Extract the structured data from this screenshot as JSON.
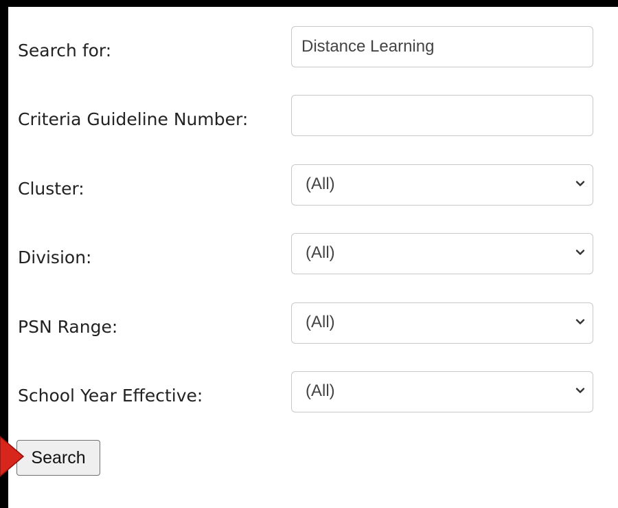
{
  "form": {
    "search_for": {
      "label": "Search for:",
      "value": "Distance Learning"
    },
    "criteria_guideline_number": {
      "label": "Criteria Guideline Number:",
      "value": ""
    },
    "cluster": {
      "label": "Cluster:",
      "selected": "(All)"
    },
    "division": {
      "label": "Division:",
      "selected": "(All)"
    },
    "psn_range": {
      "label": "PSN Range:",
      "selected": "(All)"
    },
    "school_year_effective": {
      "label": "School Year Effective:",
      "selected": "(All)"
    },
    "search_button_label": "Search"
  },
  "icons": {
    "select_chevron": "chevron-down-icon",
    "pointer": "red-arrow-icon"
  },
  "colors": {
    "background": "#000000",
    "panel": "#ffffff",
    "arrow": "#d9261c"
  }
}
